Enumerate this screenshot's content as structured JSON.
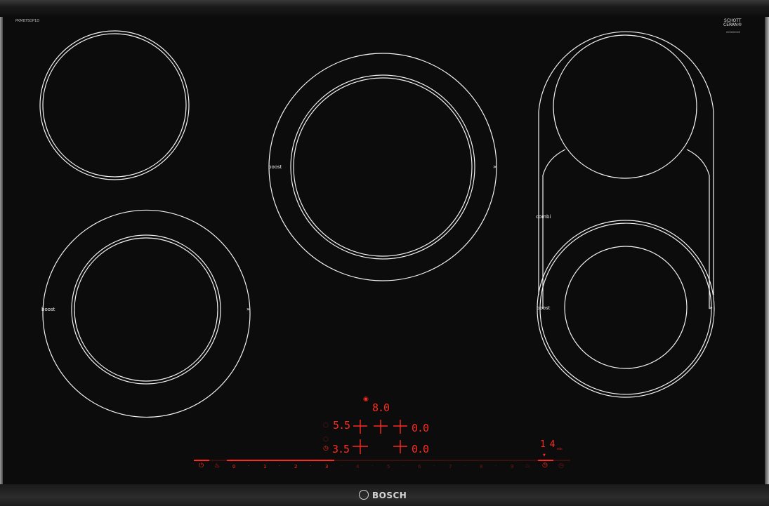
{
  "hob": {
    "model": "PKM875DP1D",
    "glass_brand_line1": "SCHOTT",
    "glass_brand_line2": "CERAN®",
    "glass_code": "000000000",
    "brand": "BOSCH"
  },
  "zones": {
    "center_boost_label": "boost",
    "left_boost_label": "boost",
    "right_combi_label": "combi",
    "right_boost_label": "boost",
    "expand_icon": "chevron-up-double-icon"
  },
  "controls": {
    "timer_main": "8.0",
    "zone_left_top_level": "5.5",
    "zone_right_top_level": "0.0",
    "zone_left_bottom_level": "3.5",
    "zone_right_bottom_level": "0.0",
    "clock_display": "1 4",
    "clock_unit": "min",
    "slider_levels": [
      "0",
      "1",
      "2",
      "3",
      "4",
      "5",
      "6",
      "7",
      "8",
      "9"
    ],
    "active_level_index": 3,
    "accent_color": "#ff2a20",
    "dim_color": "#6a1a16",
    "icons": [
      "power-icon",
      "cooking-sensor-icon",
      "timer-icon",
      "alarm-icon"
    ]
  }
}
